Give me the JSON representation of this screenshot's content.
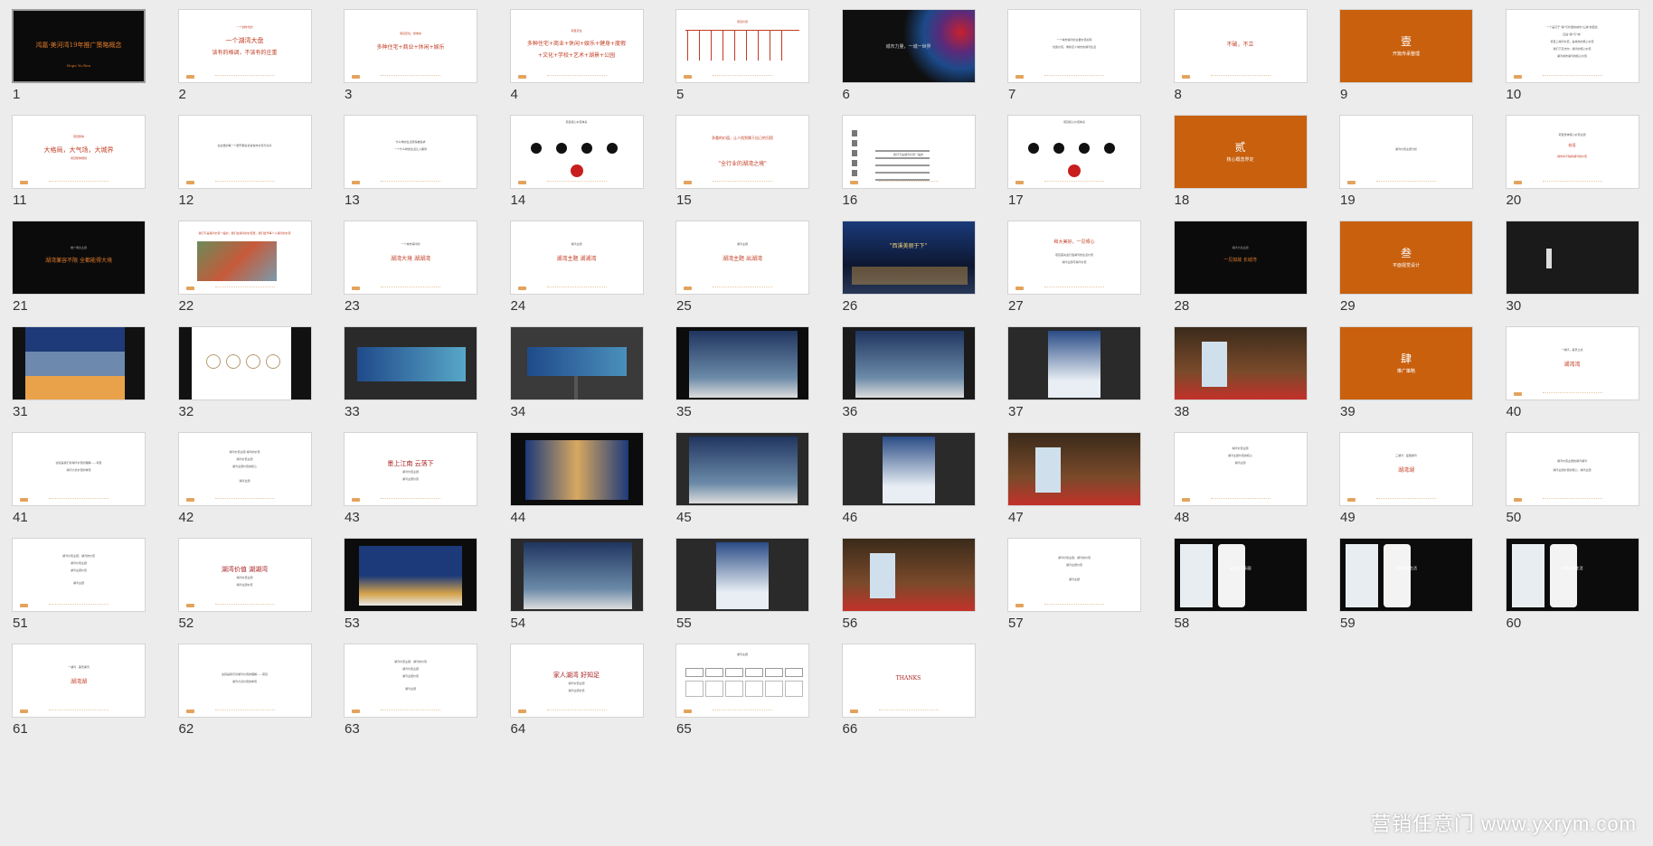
{
  "slides": [
    {
      "n": "1",
      "bg": "#0b0b0b",
      "lines": [
        {
          "text": "鸿嘉·美河湾19年推广策略概念",
          "y": 34,
          "color": "#e07a2a",
          "size": 7
        },
        {
          "text": "Hope Yu Ren",
          "y": 58,
          "color": "#e07a2a",
          "size": 4
        }
      ],
      "selected": true
    },
    {
      "n": "2",
      "bg": "#ffffff",
      "lines": [
        {
          "text": "一个划时代的",
          "y": 18,
          "color": "#c23b22",
          "size": 3
        },
        {
          "text": "一个湖湾大盘",
          "y": 30,
          "color": "#c23b22",
          "size": 7
        },
        {
          "text": "该有的格调，不该有的庄重",
          "y": 44,
          "color": "#c23b22",
          "size": 6
        }
      ]
    },
    {
      "n": "3",
      "bg": "#ffffff",
      "lines": [
        {
          "text": "项目定位，整体的",
          "y": 25,
          "color": "#c23b22",
          "size": 3
        },
        {
          "text": "多种住宅+商业+休闲+娱乐",
          "y": 38,
          "color": "#c23b22",
          "size": 6
        }
      ]
    },
    {
      "n": "4",
      "bg": "#ffffff",
      "lines": [
        {
          "text": "项目定位",
          "y": 22,
          "color": "#c23b22",
          "size": 3
        },
        {
          "text": "多种住宅+商业+休闲+娱乐+健身+度假",
          "y": 34,
          "color": "#c23b22",
          "size": 6
        },
        {
          "text": "+文化+学校+艺术+湖景+公园",
          "y": 47,
          "color": "#c23b22",
          "size": 6
        }
      ]
    },
    {
      "n": "5",
      "bg": "#ffffff",
      "type": "table",
      "lines": [
        {
          "text": "项目价值",
          "y": 12,
          "color": "#c23b22",
          "size": 3
        }
      ]
    },
    {
      "n": "6",
      "bg": "#0f0f0f",
      "type": "splash",
      "lines": [
        {
          "text": "城市力量，一城一世界",
          "y": 38,
          "color": "#d9d9d9",
          "size": 5
        }
      ]
    },
    {
      "n": "7",
      "bg": "#ffffff",
      "lines": [
        {
          "text": "一个城市湖湾的主要价值如何",
          "y": 32,
          "color": "#555",
          "size": 3
        },
        {
          "text": "创造价值，重新定义城市的湖湾生活",
          "y": 40,
          "color": "#555",
          "size": 3
        }
      ]
    },
    {
      "n": "8",
      "bg": "#ffffff",
      "lines": [
        {
          "text": "不破，不立",
          "y": 35,
          "color": "#c23b22",
          "size": 6
        }
      ]
    },
    {
      "n": "9",
      "bg": "#c8600e",
      "lines": [
        {
          "text": "壹",
          "y": 28,
          "color": "#ffffff",
          "size": 12
        },
        {
          "text": "开篇传承整理",
          "y": 46,
          "color": "#ffffff",
          "size": 5
        }
      ]
    },
    {
      "n": "10",
      "bg": "#ffffff",
      "lines": [
        {
          "text": "一个是沉于\"湖\"与外部的城市\"山湖\"的结合",
          "y": 18,
          "color": "#555",
          "size": 3
        },
        {
          "text": "还是\"湖\"与\"城\"",
          "y": 26,
          "color": "#555",
          "size": 3
        },
        {
          "text": "项目上湖湾价值，是城市的核心价值",
          "y": 34,
          "color": "#555",
          "size": 3
        },
        {
          "text": "我们下定方向：湖湾的核心价值",
          "y": 42,
          "color": "#555",
          "size": 3
        },
        {
          "text": "湖湾城市湖湾的核心价值",
          "y": 50,
          "color": "#555",
          "size": 3
        }
      ]
    },
    {
      "n": "11",
      "bg": "#ffffff",
      "lines": [
        {
          "text": "项目整体",
          "y": 22,
          "color": "#c23b22",
          "size": 3
        },
        {
          "text": "大格局，大气场，大城界",
          "y": 34,
          "color": "#c23b22",
          "size": 7
        },
        {
          "text": "项目整体规划",
          "y": 46,
          "color": "#c23b22",
          "size": 3
        }
      ]
    },
    {
      "n": "12",
      "bg": "#ffffff",
      "lines": [
        {
          "text": "在这里的每一个细节都在诉说城市价值与共享",
          "y": 32,
          "color": "#555",
          "size": 3
        }
      ]
    },
    {
      "n": "13",
      "bg": "#ffffff",
      "lines": [
        {
          "text": "什么样的生活值得被追求",
          "y": 28,
          "color": "#555",
          "size": 3
        },
        {
          "text": "一个什么样的生活让人期待",
          "y": 36,
          "color": "#555",
          "size": 3
        }
      ]
    },
    {
      "n": "14",
      "bg": "#ffffff",
      "type": "circles",
      "lines": [
        {
          "text": "项目核心价值体系",
          "y": 6,
          "color": "#555",
          "size": 3
        }
      ]
    },
    {
      "n": "15",
      "bg": "#ffffff",
      "lines": [
        {
          "text": "多重的价值，让人找到属于自己的归宿",
          "y": 22,
          "color": "#c23b22",
          "size": 4
        },
        {
          "text": "\"全行业的湖湾之境\"",
          "y": 50,
          "color": "#c23b22",
          "size": 6
        }
      ]
    },
    {
      "n": "16",
      "bg": "#ffffff",
      "type": "vertical",
      "lines": [
        {
          "text": "我们不是湖湾价值一般的",
          "y": 42,
          "color": "#555",
          "size": 3
        }
      ]
    },
    {
      "n": "17",
      "bg": "#ffffff",
      "type": "circles2",
      "lines": [
        {
          "text": "项目核心价值体系",
          "y": 6,
          "color": "#555",
          "size": 3
        }
      ]
    },
    {
      "n": "18",
      "bg": "#c8600e",
      "lines": [
        {
          "text": "贰",
          "y": 28,
          "color": "#ffffff",
          "size": 12
        },
        {
          "text": "核心概念界定",
          "y": 46,
          "color": "#ffffff",
          "size": 5
        }
      ]
    },
    {
      "n": "19",
      "bg": "#ffffff",
      "lines": [
        {
          "text": "湖湾价值主题分析",
          "y": 36,
          "color": "#555",
          "size": 3
        }
      ]
    },
    {
      "n": "20",
      "bg": "#ffffff",
      "lines": [
        {
          "text": "项目整体核心价值主题",
          "y": 20,
          "color": "#555",
          "size": 3
        },
        {
          "text": "结语",
          "y": 30,
          "color": "#c23b22",
          "size": 4
        },
        {
          "text": "城市中不缺的湖湾的价值",
          "y": 44,
          "color": "#c23b22",
          "size": 3
        }
      ]
    },
    {
      "n": "21",
      "bg": "#0b0b0b",
      "lines": [
        {
          "text": "推广概念主题",
          "y": 28,
          "color": "#aaa",
          "size": 3
        },
        {
          "text": "湖湾兼容不限 全都能得大境",
          "y": 40,
          "color": "#e07a2a",
          "size": 6
        }
      ]
    },
    {
      "n": "22",
      "bg": "#ffffff",
      "type": "aerial",
      "lines": [
        {
          "text": "我们不是湖湾价值一般的，我们在湖湾的价值里，我们给予每个人湖湾的价值",
          "y": 12,
          "color": "#c23b22",
          "size": 3
        }
      ]
    },
    {
      "n": "23",
      "bg": "#ffffff",
      "lines": [
        {
          "text": "一个城市湖湾的",
          "y": 24,
          "color": "#555",
          "size": 3
        },
        {
          "text": "湖湾大境 湖湖湾",
          "y": 38,
          "color": "#c23b22",
          "size": 6
        }
      ]
    },
    {
      "n": "24",
      "bg": "#ffffff",
      "lines": [
        {
          "text": "湖湾主题",
          "y": 24,
          "color": "#555",
          "size": 3
        },
        {
          "text": "湖湾主题 湖湖湾",
          "y": 38,
          "color": "#c23b22",
          "size": 6
        }
      ]
    },
    {
      "n": "25",
      "bg": "#ffffff",
      "lines": [
        {
          "text": "湖湾主题",
          "y": 24,
          "color": "#555",
          "size": 3
        },
        {
          "text": "湖湾主题 出湖湾",
          "y": 38,
          "color": "#c23b22",
          "size": 6
        }
      ]
    },
    {
      "n": "26",
      "bg": "#1d2a4a",
      "type": "night",
      "lines": [
        {
          "text": "\"西溪美丽于下\"",
          "y": 24,
          "color": "#f0d27a",
          "size": 6
        }
      ]
    },
    {
      "n": "27",
      "bg": "#ffffff",
      "lines": [
        {
          "text": "和大美好，一见倾心",
          "y": 20,
          "color": "#c23b22",
          "size": 5
        },
        {
          "text": "项目首先会打造湖湾的生活价值",
          "y": 36,
          "color": "#555",
          "size": 3
        },
        {
          "text": "湖湾主题与湖湾价值",
          "y": 44,
          "color": "#555",
          "size": 3
        }
      ]
    },
    {
      "n": "28",
      "bg": "#0b0b0b",
      "lines": [
        {
          "text": "湖湾大境主题",
          "y": 28,
          "color": "#aaa",
          "size": 3
        },
        {
          "text": "一见如故 长城湾",
          "y": 40,
          "color": "#e07a2a",
          "size": 5
        }
      ]
    },
    {
      "n": "29",
      "bg": "#c8600e",
      "lines": [
        {
          "text": "叁",
          "y": 28,
          "color": "#ffffff",
          "size": 12
        },
        {
          "text": "平面视觉设计",
          "y": 46,
          "color": "#ffffff",
          "size": 5
        }
      ]
    },
    {
      "n": "30",
      "bg": "#1a1a1a",
      "type": "logo",
      "lines": []
    },
    {
      "n": "31",
      "bg": "#111111",
      "type": "logobands",
      "lines": []
    },
    {
      "n": "32",
      "bg": "#111111",
      "type": "seals",
      "lines": []
    },
    {
      "n": "33",
      "bg": "#2a2a2a",
      "type": "banner",
      "lines": []
    },
    {
      "n": "34",
      "bg": "#3a3a3a",
      "type": "billboard",
      "lines": []
    },
    {
      "n": "35",
      "bg": "#0c0c0c",
      "type": "bus",
      "lines": []
    },
    {
      "n": "36",
      "bg": "#1a1a1a",
      "type": "bus",
      "lines": []
    },
    {
      "n": "37",
      "bg": "#2a2a2a",
      "type": "poster",
      "lines": []
    },
    {
      "n": "38",
      "bg": "#1c1c1c",
      "type": "street",
      "lines": []
    },
    {
      "n": "39",
      "bg": "#c8600e",
      "lines": [
        {
          "text": "肆",
          "y": 28,
          "color": "#ffffff",
          "size": 12
        },
        {
          "text": "推广策略",
          "y": 46,
          "color": "#ffffff",
          "size": 5
        }
      ]
    },
    {
      "n": "40",
      "bg": "#ffffff",
      "lines": [
        {
          "text": "一湖湾，美景之境",
          "y": 24,
          "color": "#555",
          "size": 3
        },
        {
          "text": "湖湾湾",
          "y": 38,
          "color": "#c23b22",
          "size": 6
        }
      ]
    },
    {
      "n": "41",
      "bg": "#ffffff",
      "lines": [
        {
          "text": "这就是我们对湖湾价值的理解——项目",
          "y": 32,
          "color": "#555",
          "size": 3
        },
        {
          "text": "湖湾大境价值的体现",
          "y": 40,
          "color": "#555",
          "size": 3
        }
      ]
    },
    {
      "n": "42",
      "bg": "#ffffff",
      "lines": [
        {
          "text": "湖湾价值主题 湖湾的价值",
          "y": 20,
          "color": "#555",
          "size": 3
        },
        {
          "text": "湖湾价值主题",
          "y": 28,
          "color": "#555",
          "size": 3
        },
        {
          "text": "湖湾主题价值的核心",
          "y": 36,
          "color": "#555",
          "size": 3
        },
        {
          "text": "湖湾主题",
          "y": 52,
          "color": "#555",
          "size": 3
        }
      ]
    },
    {
      "n": "43",
      "bg": "#ffffff",
      "lines": [
        {
          "text": "墨上江南 云落下",
          "y": 30,
          "color": "#a81d1d",
          "size": 7
        },
        {
          "text": "湖湾价值主题",
          "y": 42,
          "color": "#555",
          "size": 3
        },
        {
          "text": "湖湾主题价值",
          "y": 50,
          "color": "#555",
          "size": 3
        }
      ]
    },
    {
      "n": "44",
      "bg": "#0c0c0c",
      "type": "poster2",
      "lines": []
    },
    {
      "n": "45",
      "bg": "#2a2a2a",
      "type": "bus",
      "lines": []
    },
    {
      "n": "46",
      "bg": "#2a2a2a",
      "type": "poster",
      "lines": []
    },
    {
      "n": "47",
      "bg": "#1c1c1c",
      "type": "street",
      "lines": []
    },
    {
      "n": "48",
      "bg": "#ffffff",
      "lines": [
        {
          "text": "湖湾价值主题",
          "y": 16,
          "color": "#555",
          "size": 3
        },
        {
          "text": "湖湾主题价值的核心",
          "y": 24,
          "color": "#555",
          "size": 3
        },
        {
          "text": "湖湾主题",
          "y": 32,
          "color": "#555",
          "size": 3
        }
      ]
    },
    {
      "n": "49",
      "bg": "#ffffff",
      "lines": [
        {
          "text": "三湖湾 · 宜居湖湾",
          "y": 24,
          "color": "#555",
          "size": 3
        },
        {
          "text": "湖湾湖",
          "y": 38,
          "color": "#c23b22",
          "size": 6
        }
      ]
    },
    {
      "n": "50",
      "bg": "#ffffff",
      "lines": [
        {
          "text": "湖湾价值主题的湖湾湖湾",
          "y": 30,
          "color": "#555",
          "size": 3
        },
        {
          "text": "湖湾主题价值的核心，湖湾主题",
          "y": 40,
          "color": "#555",
          "size": 3
        }
      ]
    },
    {
      "n": "51",
      "bg": "#ffffff",
      "lines": [
        {
          "text": "湖湾价值主题，湖湾的价值",
          "y": 18,
          "color": "#555",
          "size": 3
        },
        {
          "text": "湖湾价值主题",
          "y": 26,
          "color": "#555",
          "size": 3
        },
        {
          "text": "湖湾主题价值",
          "y": 34,
          "color": "#555",
          "size": 3
        },
        {
          "text": "湖湾主题",
          "y": 48,
          "color": "#555",
          "size": 3
        }
      ]
    },
    {
      "n": "52",
      "bg": "#ffffff",
      "lines": [
        {
          "text": "湖湾价值 湖湖湾",
          "y": 30,
          "color": "#a81d1d",
          "size": 7
        },
        {
          "text": "湖湾价值主题",
          "y": 42,
          "color": "#555",
          "size": 3
        },
        {
          "text": "湖湾主题价值",
          "y": 50,
          "color": "#555",
          "size": 3
        }
      ]
    },
    {
      "n": "53",
      "bg": "#0c0c0c",
      "type": "mountain",
      "lines": []
    },
    {
      "n": "54",
      "bg": "#2a2a2a",
      "type": "bus",
      "lines": []
    },
    {
      "n": "55",
      "bg": "#2a2a2a",
      "type": "poster",
      "lines": []
    },
    {
      "n": "56",
      "bg": "#1c1c1c",
      "type": "street",
      "lines": []
    },
    {
      "n": "57",
      "bg": "#ffffff",
      "lines": [
        {
          "text": "湖湾价值主题，湖湾的价值",
          "y": 20,
          "color": "#555",
          "size": 3
        },
        {
          "text": "湖湾主题价值",
          "y": 28,
          "color": "#555",
          "size": 3
        },
        {
          "text": "湖湾主题",
          "y": 44,
          "color": "#555",
          "size": 3
        }
      ]
    },
    {
      "n": "58",
      "bg": "#0c0c0c",
      "type": "phone",
      "lines": [
        {
          "text": "云端生活乐园",
          "y": 30,
          "color": "#ffffff",
          "size": 4
        }
      ]
    },
    {
      "n": "59",
      "bg": "#0c0c0c",
      "type": "phone",
      "lines": [
        {
          "text": "智慧湖湾生活",
          "y": 30,
          "color": "#ffffff",
          "size": 4
        }
      ]
    },
    {
      "n": "60",
      "bg": "#0c0c0c",
      "type": "phone",
      "lines": [
        {
          "text": "湖湾全景生活",
          "y": 30,
          "color": "#ffffff",
          "size": 4
        }
      ]
    },
    {
      "n": "61",
      "bg": "#ffffff",
      "lines": [
        {
          "text": "一湖湾 · 美景湖湾",
          "y": 24,
          "color": "#555",
          "size": 3
        },
        {
          "text": "湖湾湖",
          "y": 38,
          "color": "#c23b22",
          "size": 6
        }
      ]
    },
    {
      "n": "62",
      "bg": "#ffffff",
      "lines": [
        {
          "text": "这就是我们对湖湾价值的理解——项目",
          "y": 32,
          "color": "#555",
          "size": 3
        },
        {
          "text": "湖湾大境价值的体现",
          "y": 40,
          "color": "#555",
          "size": 3
        }
      ]
    },
    {
      "n": "63",
      "bg": "#ffffff",
      "lines": [
        {
          "text": "湖湾价值主题，湖湾的价值",
          "y": 18,
          "color": "#555",
          "size": 3
        },
        {
          "text": "湖湾价值主题",
          "y": 26,
          "color": "#555",
          "size": 3
        },
        {
          "text": "湖湾主题价值",
          "y": 34,
          "color": "#555",
          "size": 3
        },
        {
          "text": "湖湾主题",
          "y": 48,
          "color": "#555",
          "size": 3
        }
      ]
    },
    {
      "n": "64",
      "bg": "#ffffff",
      "lines": [
        {
          "text": "家人湖湾 好知足",
          "y": 30,
          "color": "#a81d1d",
          "size": 7
        },
        {
          "text": "湖湾价值主题",
          "y": 42,
          "color": "#555",
          "size": 3
        },
        {
          "text": "湖湾主题价值",
          "y": 50,
          "color": "#555",
          "size": 3
        }
      ]
    },
    {
      "n": "65",
      "bg": "#ffffff",
      "type": "flow",
      "lines": [
        {
          "text": "湖湾主题",
          "y": 10,
          "color": "#555",
          "size": 3
        }
      ]
    },
    {
      "n": "66",
      "bg": "#ffffff",
      "lines": [
        {
          "text": "THANKS",
          "y": 34,
          "color": "#a81d1d",
          "size": 6
        }
      ]
    }
  ],
  "watermark": "营销任意门 www.yxrym.com"
}
